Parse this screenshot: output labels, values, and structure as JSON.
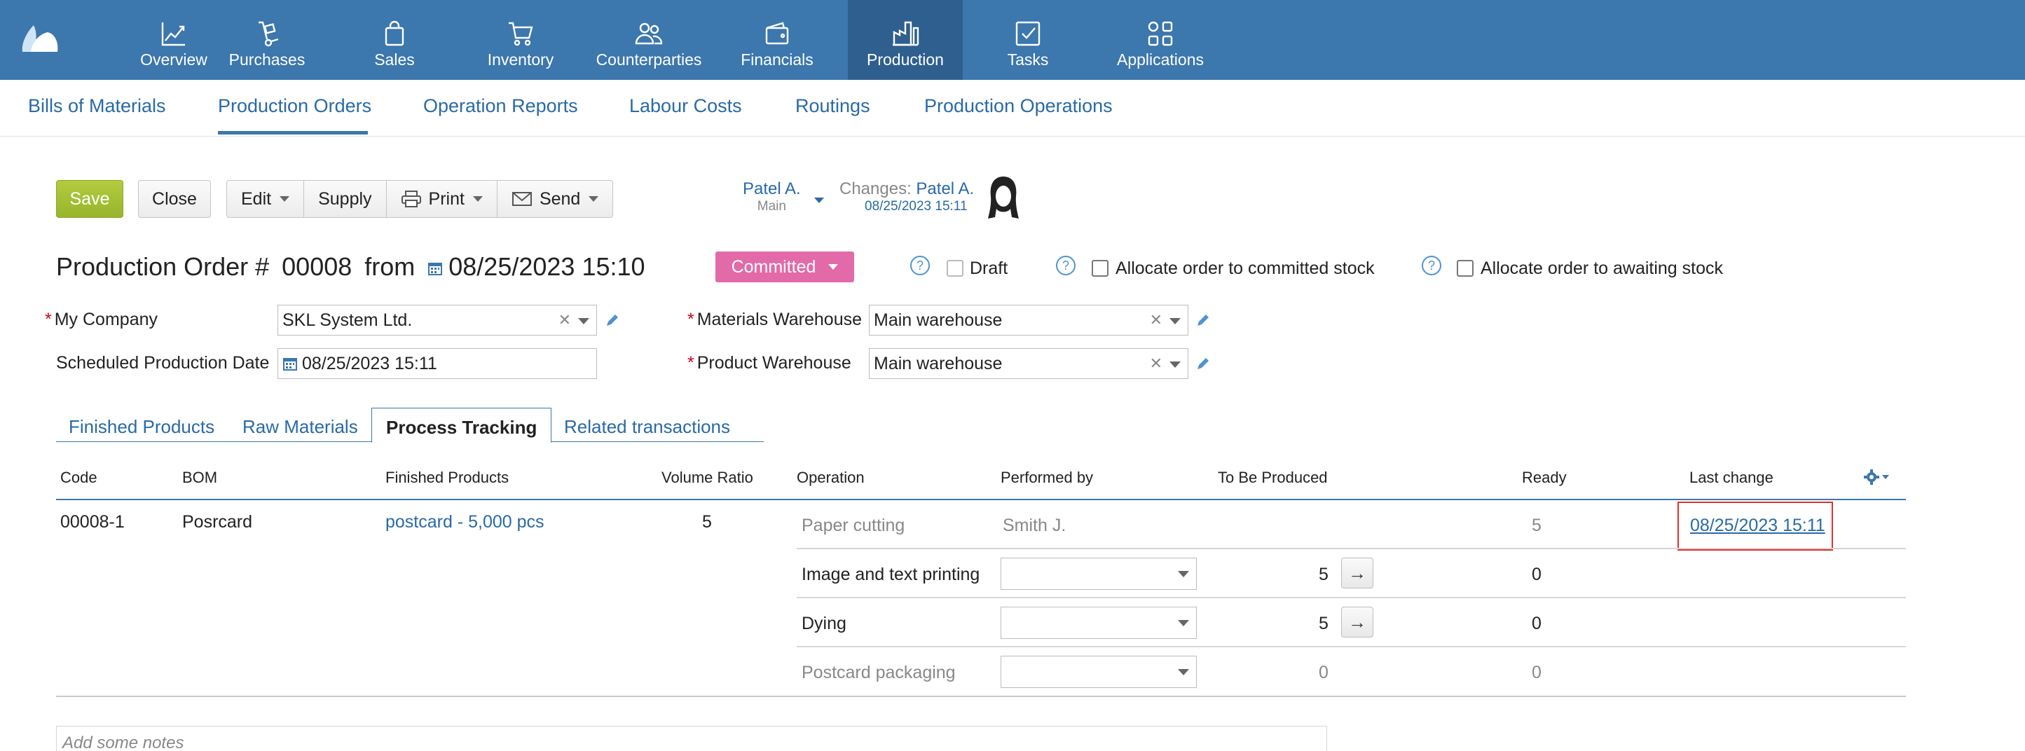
{
  "topnav": {
    "items": [
      {
        "label": "Overview",
        "icon": "chart-line-icon"
      },
      {
        "label": "Purchases",
        "icon": "hand-truck-icon"
      },
      {
        "label": "Sales",
        "icon": "shopping-bag-icon"
      },
      {
        "label": "Inventory",
        "icon": "cart-icon"
      },
      {
        "label": "Counterparties",
        "icon": "people-icon"
      },
      {
        "label": "Financials",
        "icon": "wallet-icon"
      },
      {
        "label": "Production",
        "icon": "factory-icon",
        "active": true
      },
      {
        "label": "Tasks",
        "icon": "checkbox-icon"
      },
      {
        "label": "Applications",
        "icon": "apps-grid-icon"
      }
    ],
    "color": "#3c77ad",
    "active_color": "#2e5f8e"
  },
  "subnav": {
    "items": [
      {
        "label": "Bills of Materials"
      },
      {
        "label": "Production Orders",
        "active": true
      },
      {
        "label": "Operation Reports"
      },
      {
        "label": "Labour Costs"
      },
      {
        "label": "Routings"
      },
      {
        "label": "Production Operations"
      }
    ]
  },
  "toolbar": {
    "save_label": "Save",
    "close_label": "Close",
    "edit_label": "Edit",
    "supply_label": "Supply",
    "print_label": "Print",
    "send_label": "Send"
  },
  "user": {
    "name": "Patel A.",
    "sub": "Main",
    "changes_prefix": "Changes:",
    "changes_name": "Patel A.",
    "changes_date": "08/25/2023 15:11"
  },
  "header": {
    "title": "Production Order #",
    "number": "00008",
    "from": "from",
    "date": "08/25/2023 15:10",
    "status": "Committed",
    "status_color": "#e36aa8",
    "draft_label": "Draft",
    "allocate_committed_label": "Allocate order to committed stock",
    "allocate_awaiting_label": "Allocate order to awaiting stock"
  },
  "form": {
    "company_label": "My Company",
    "company_value": "SKL System Ltd.",
    "sched_label": "Scheduled Production Date",
    "sched_value": "08/25/2023 15:11",
    "materials_wh_label": "Materials Warehouse",
    "materials_wh_value": "Main warehouse",
    "product_wh_label": "Product Warehouse",
    "product_wh_value": "Main warehouse"
  },
  "tabs": {
    "finished": "Finished Products",
    "raw": "Raw Materials",
    "process": "Process Tracking",
    "related": "Related transactions"
  },
  "table": {
    "headers": {
      "code": "Code",
      "bom": "BOM",
      "finished": "Finished Products",
      "volume": "Volume Ratio",
      "operation": "Operation",
      "performed": "Performed by",
      "to_produce": "To Be Produced",
      "ready": "Ready",
      "last_change": "Last change"
    },
    "order": {
      "code": "00008-1",
      "bom": "Posrcard",
      "finished": "postcard - 5,000 pcs",
      "volume": "5"
    },
    "operations": [
      {
        "name": "Paper cutting",
        "performed": "Smith J.",
        "to_produce": "",
        "ready": "5",
        "last_change": "08/25/2023 15:11"
      },
      {
        "name": "Image and text printing",
        "performed": "",
        "to_produce": "5",
        "ready": "0"
      },
      {
        "name": "Dying",
        "performed": "",
        "to_produce": "5",
        "ready": "0"
      },
      {
        "name": "Postcard packaging",
        "performed": "",
        "to_produce": "0",
        "ready": "0"
      }
    ]
  },
  "notes": {
    "placeholder": "Add some notes"
  }
}
